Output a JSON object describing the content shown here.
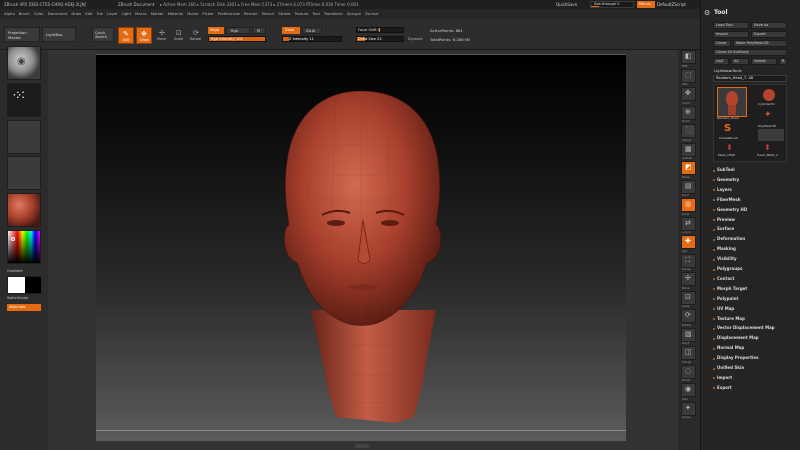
{
  "title_bar": {
    "app_title": "ZBrush 4R5 [DES-CTES-CHRQ-ADEJ-2LJN]",
    "document": "ZBrush Document",
    "stats": "▸ Active Mem 160 ▸ Scratch Disk 3301 ▸ Free Mem 5373 ▸ 27mem 6.073 RTimes 6.036 Timer 0.001",
    "quicksave": "QuickSave",
    "see_through": "See-through 0",
    "menus_btn": "Menus",
    "script_label": "DefaultZScript"
  },
  "menu_bar": [
    "Alpha",
    "Brush",
    "Color",
    "Document",
    "Draw",
    "Edit",
    "File",
    "Layer",
    "Light",
    "Macro",
    "Marker",
    "Material",
    "Movie",
    "Picker",
    "Preferences",
    "Render",
    "Stencil",
    "Stroke",
    "Texture",
    "Tool",
    "Transform",
    "Zplugin",
    "Zscript"
  ],
  "shelf": {
    "projection_master": "Projection Master",
    "lightbox": "LightBox",
    "quick_sketch": "Quick Sketch",
    "edit": "Edit",
    "draw": "Draw",
    "move": "Move",
    "scale": "Scale",
    "rotate": "Rotate",
    "mrgb": "Mrgb",
    "rgb": "Rgb",
    "m": "M",
    "rgb_intensity": "Rgb Intensity 100",
    "zadd": "Zadd",
    "zsub": "Zsub",
    "z_intensity": "Z Intensity 11",
    "focal_shift": "Focal Shift 0",
    "draw_size": "Draw Size 22",
    "dynamic": "Dynamic",
    "active_points": "ActivePoints: 881",
    "total_points": "TotalPoints: 6.288 Mil"
  },
  "left_tray": {
    "gradient": "Gradient",
    "switch_color": "SwitchColor",
    "alternate": "Alternate"
  },
  "right_strip": [
    "BPR",
    "SPix",
    "Scroll",
    "Zoom",
    "Actual",
    "AAHalf",
    "Persp",
    "Floor",
    "Local",
    "L.Sym",
    "Xyz",
    "Frame",
    "Move",
    "Scale",
    "Rotate",
    "PolyF",
    "Transp",
    "Ghost",
    "Solo",
    "Xpose"
  ],
  "palette": {
    "title": "Tool",
    "load_tool": "Load Tool",
    "save_as": "Save As",
    "import": "Import",
    "export": "Export",
    "clone": "Clone",
    "make_polymesh": "Make PolyMesh3D",
    "clone_all": "Clone All SubTools",
    "goz": "GoZ",
    "all": "All",
    "visible": "Visible",
    "r": "R",
    "lightbox_tools": "Lightbox▸Tools",
    "current_tool": "Random_Head_7. 48",
    "tool_thumbs": [
      "Random_Head",
      "Cylinder3D",
      "SimpleBrush",
      "PolyMesh3D",
      "Mask_OFAR",
      "Head_SBAR_2"
    ],
    "items": [
      "SubTool",
      "Geometry",
      "Layers",
      "FiberMesh",
      "Geometry HD",
      "Preview",
      "Surface",
      "Deformation",
      "Masking",
      "Visibility",
      "Polygroups",
      "Contact",
      "Morph Target",
      "Polypaint",
      "UV Map",
      "Texture Map",
      "Vector Displacement Map",
      "Displacement Map",
      "Normal Map",
      "Display Properties",
      "Unified Skin",
      "Import",
      "Export"
    ]
  },
  "colors": {
    "accent": "#e56b12",
    "head": "#b84a38",
    "panel": "#2b2b2b"
  }
}
